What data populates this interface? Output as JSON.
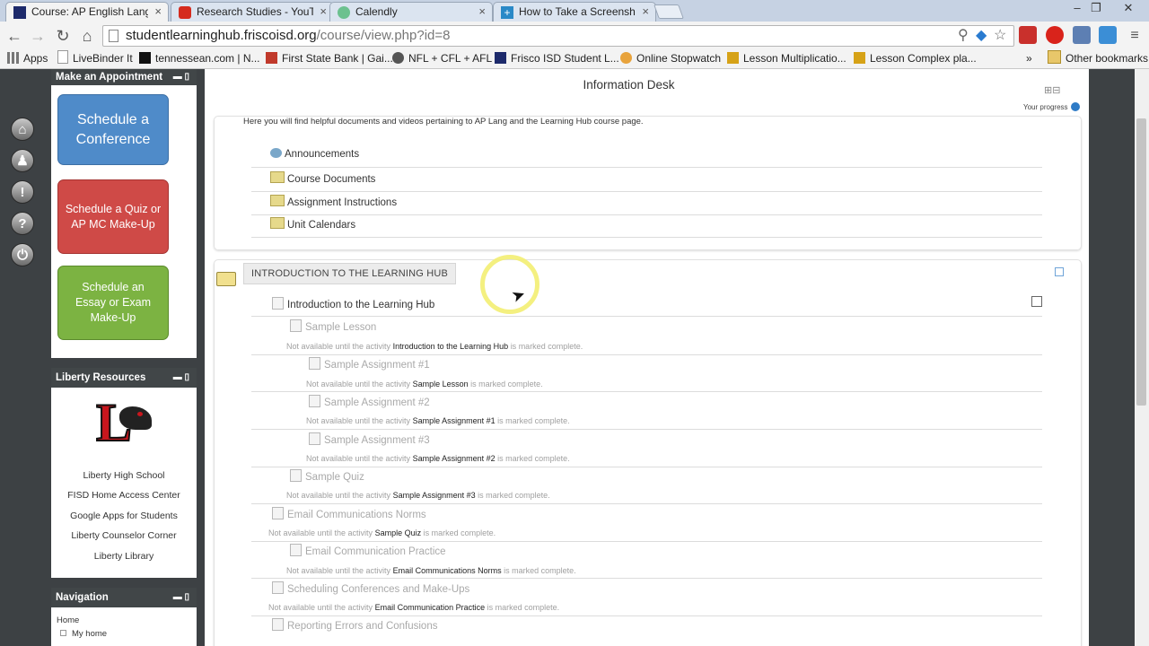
{
  "browser": {
    "tabs": [
      {
        "title": "Course: AP English Langu",
        "active": true
      },
      {
        "title": "Research Studies - YouTul",
        "active": false
      },
      {
        "title": "Calendly",
        "active": false
      },
      {
        "title": "How to Take a Screenshot",
        "active": false
      }
    ],
    "url_host": "studentlearninghub.friscoisd.org",
    "url_path": "/course/view.php?id=8",
    "apps_label": "Apps",
    "bookmarks": [
      "LiveBinder It",
      "tennessean.com | N...",
      "First State Bank | Gai...",
      "NFL + CFL + AFL",
      "Frisco ISD Student L...",
      "Online Stopwatch",
      "Lesson Multiplicatio...",
      "Lesson Complex pla..."
    ],
    "more_bookmarks": "»",
    "other_bookmarks": "Other bookmarks"
  },
  "appointment": {
    "title": "Make an Appointment",
    "btn_conference": "Schedule a Conference",
    "btn_quiz": "Schedule a Quiz or AP MC Make-Up",
    "btn_essay": "Schedule an Essay or Exam Make-Up"
  },
  "resources": {
    "title": "Liberty Resources",
    "logo_letter": "L",
    "links": [
      "Liberty High School",
      "FISD Home Access Center",
      "Google Apps for Students",
      "Liberty Counselor Corner",
      "Liberty Library"
    ]
  },
  "navigation": {
    "title": "Navigation",
    "home": "Home",
    "my_home": "My home"
  },
  "course": {
    "section_title": "Information Desk",
    "progress_label": "Your progress",
    "summary": "Here you will find helpful documents and videos pertaining to AP Lang and the Learning Hub course page.",
    "info_items": [
      "Announcements",
      "Course Documents",
      "Assignment Instructions",
      "Unit Calendars"
    ],
    "topic_title": "INTRODUCTION TO THE LEARNING HUB",
    "availability_prefix": "Not available until the activity",
    "availability_suffix": "is marked complete.",
    "activities": [
      {
        "name": "Introduction to the Learning Hub",
        "requires": ""
      },
      {
        "name": "Sample Lesson",
        "requires": "Introduction to the Learning Hub"
      },
      {
        "name": "Sample Assignment #1",
        "requires": "Sample Lesson"
      },
      {
        "name": "Sample Assignment #2",
        "requires": "Sample Assignment #1"
      },
      {
        "name": "Sample Assignment #3",
        "requires": "Sample Assignment #2"
      },
      {
        "name": "Sample Quiz",
        "requires": "Sample Assignment #3"
      },
      {
        "name": "Email Communications Norms",
        "requires": "Sample Quiz"
      },
      {
        "name": "Email Communication Practice",
        "requires": "Email Communications Norms"
      },
      {
        "name": "Scheduling Conferences and Make-Ups",
        "requires": "Email Communication Practice"
      },
      {
        "name": "Reporting Errors and Confusions",
        "requires": ""
      }
    ]
  },
  "colors": {
    "conference": "#4f8bc9",
    "quiz": "#cf4a47",
    "essay": "#7cb342",
    "block_header": "#414648",
    "highlight_ring": "#f3ee72"
  }
}
